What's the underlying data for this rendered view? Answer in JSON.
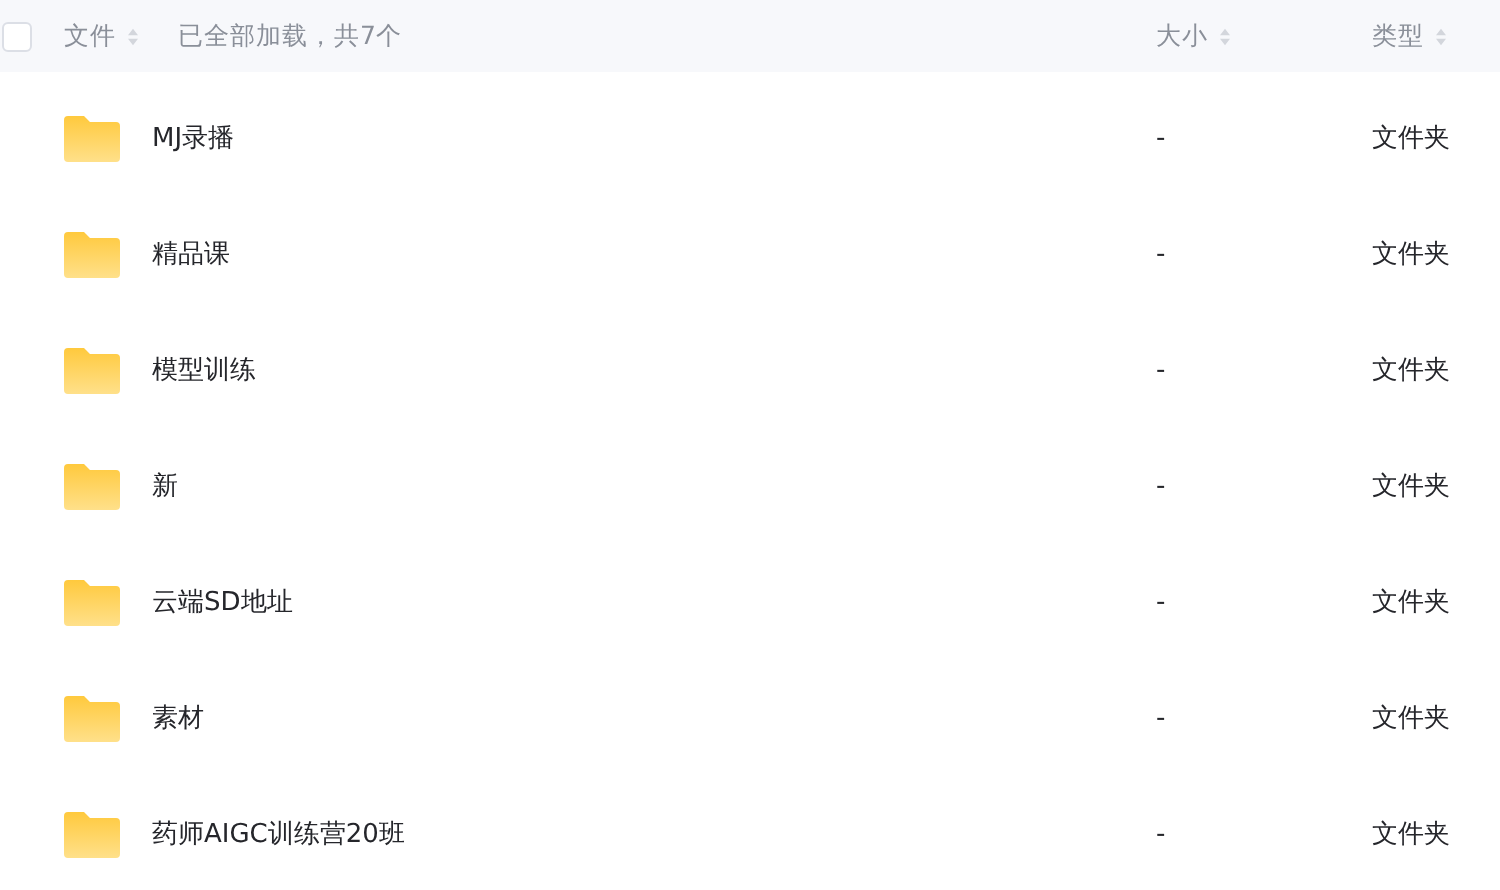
{
  "header": {
    "select_all": {
      "checked": false
    },
    "columns": [
      {
        "label": "文件",
        "sortable": true
      },
      {
        "label": "大小",
        "sortable": true
      },
      {
        "label": "类型",
        "sortable": true
      }
    ],
    "status": "已全部加载，共7个"
  },
  "rows": [
    {
      "name": "MJ录播",
      "size": "-",
      "type": "文件夹"
    },
    {
      "name": "精品课",
      "size": "-",
      "type": "文件夹"
    },
    {
      "name": "模型训练",
      "size": "-",
      "type": "文件夹"
    },
    {
      "name": "新",
      "size": "-",
      "type": "文件夹"
    },
    {
      "name": "云端SD地址",
      "size": "-",
      "type": "文件夹"
    },
    {
      "name": "素材",
      "size": "-",
      "type": "文件夹"
    },
    {
      "name": "药师AIGC训练营20班",
      "size": "-",
      "type": "文件夹"
    }
  ]
}
